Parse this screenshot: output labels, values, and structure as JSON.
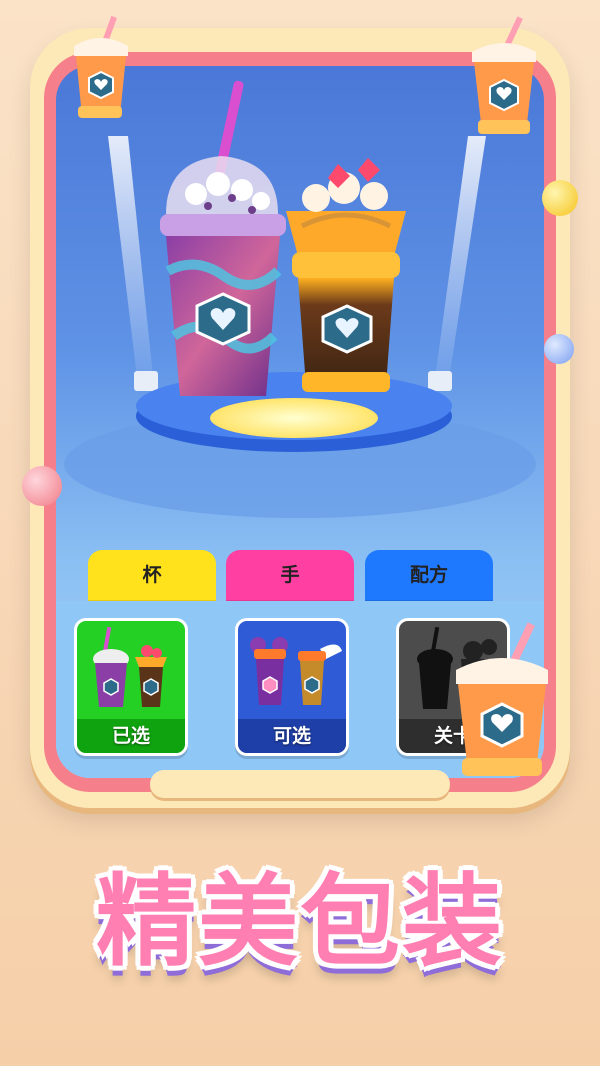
{
  "tabs": [
    {
      "label": "杯",
      "color": "#ffe11c"
    },
    {
      "label": "手",
      "color": "#ff3fa2"
    },
    {
      "label": "配方",
      "color": "#1f79ff"
    }
  ],
  "cards": [
    {
      "label": "已选",
      "state": "selected",
      "color": "#25d024"
    },
    {
      "label": "可选",
      "state": "available",
      "color": "#2f5bd6"
    },
    {
      "label": "关卡",
      "state": "locked",
      "color": "#4c4c4c"
    }
  ],
  "headline": "精美包装",
  "colors": {
    "background": "#f7d6b5",
    "frame_pink": "#f57f8a",
    "frame_cream": "#fde8b8",
    "headline_pink": "#ff7fb2"
  }
}
